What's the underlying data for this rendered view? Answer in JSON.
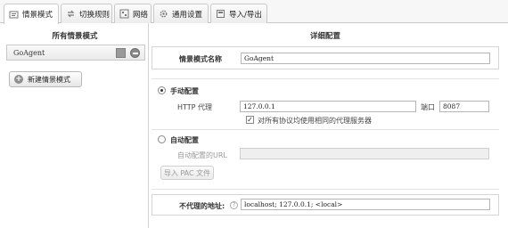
{
  "tabs": [
    {
      "label": "情景模式",
      "icon": "profile-icon",
      "active": true
    },
    {
      "label": "切换规则",
      "icon": "rules-icon",
      "active": false
    },
    {
      "label": "网络",
      "icon": "network-icon",
      "active": false
    },
    {
      "label": "通用设置",
      "icon": "settings-icon",
      "active": false
    },
    {
      "label": "导入/导出",
      "icon": "import-export-icon",
      "active": false
    }
  ],
  "left": {
    "title": "所有情景模式",
    "profiles": [
      {
        "name": "GoAgent"
      }
    ],
    "new_button": "新建情景模式"
  },
  "details": {
    "title": "详细配置",
    "profile_name_label": "情景模式名称",
    "profile_name_value": "GoAgent",
    "manual_label": "手动配置",
    "http_proxy_label": "HTTP 代理",
    "http_proxy_value": "127.0.0.1",
    "port_label": "端口",
    "port_value": "8087",
    "same_proxy_label": "对所有协议均使用相同的代理服务器",
    "same_proxy_checked": true,
    "auto_label": "自动配置",
    "auto_url_label": "自动配置的URL",
    "auto_url_value": "",
    "import_pac_button": "导入 PAC 文件",
    "bypass_label": "不代理的地址:",
    "bypass_value": "localhost; 127.0.0.1; <local>"
  }
}
